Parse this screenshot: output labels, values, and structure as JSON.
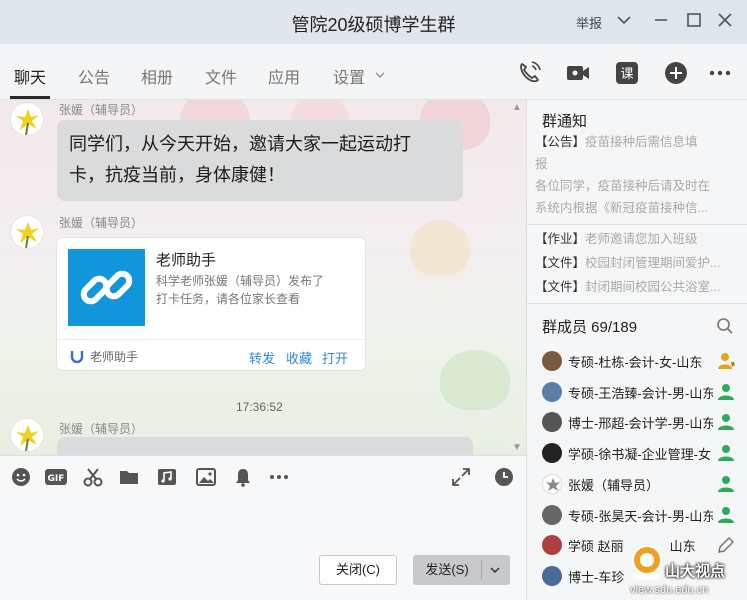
{
  "window": {
    "title": "管院20级硕博学生群",
    "report_label": "举报"
  },
  "tabs": [
    "聊天",
    "公告",
    "相册",
    "文件",
    "应用",
    "设置"
  ],
  "messages": {
    "m1": {
      "sender": "张媛（辅导员）",
      "text_line1": "同学们，从今天开始，邀请大家一起运动打",
      "text_line2": "卡，抗疫当前，身体康健！"
    },
    "m2": {
      "sender": "张媛（辅导员）",
      "card_title": "老师助手",
      "card_desc_line1": "科学老师张媛（辅导员）发布了",
      "card_desc_line2": "打卡任务，请各位家长查看",
      "card_app": "老师助手",
      "actions": [
        "转发",
        "收藏",
        "打开"
      ]
    },
    "timestamp": "17:36:52",
    "m3": {
      "sender": "张媛（辅导员）"
    }
  },
  "input": {
    "close_label": "关闭(C)",
    "send_label": "发送(S)"
  },
  "notice": {
    "title": "群通知",
    "tag_announce": "【公告】",
    "announce_title_1": "疫苗接种后需信息填",
    "announce_title_2": "报",
    "announce_body_1": "各位同学，疫苗接种后请及时在",
    "announce_body_2": "系统内根据《新冠疫苗接种信...",
    "items": [
      {
        "tag": "【作业】",
        "text": "老师邀请您加入班级"
      },
      {
        "tag": "【文件】",
        "text": "校园封闭管理期间爱护..."
      },
      {
        "tag": "【文件】",
        "text": "封闭期间校园公共浴室..."
      }
    ]
  },
  "members": {
    "title": "群成员 69/189",
    "list": [
      {
        "name": "专硕-杜栋-会计-女-山东",
        "role": "admin"
      },
      {
        "name": "专硕-王浩臻-会计-男-山东",
        "role": "member"
      },
      {
        "name": "博士-邢超-会计学-男-山东",
        "role": "member"
      },
      {
        "name": "学硕-徐书凝-企业管理-女",
        "role": "member"
      },
      {
        "name": "张媛（辅导员）",
        "role": "member"
      },
      {
        "name": "专硕-张昊天-会计-男-山东",
        "role": "member"
      },
      {
        "name": "学硕 赵丽",
        "role": "edit"
      },
      {
        "name": "博士-车珍",
        "role": "member"
      }
    ],
    "extra": "山东"
  },
  "watermark": {
    "text": "山大视点",
    "url": "view.sdu.edu.cn"
  },
  "colors": {
    "accent": "#1296db",
    "link": "#2e8ad8",
    "member_icon": "#2eaa5a",
    "admin_icon": "#e8a317"
  }
}
